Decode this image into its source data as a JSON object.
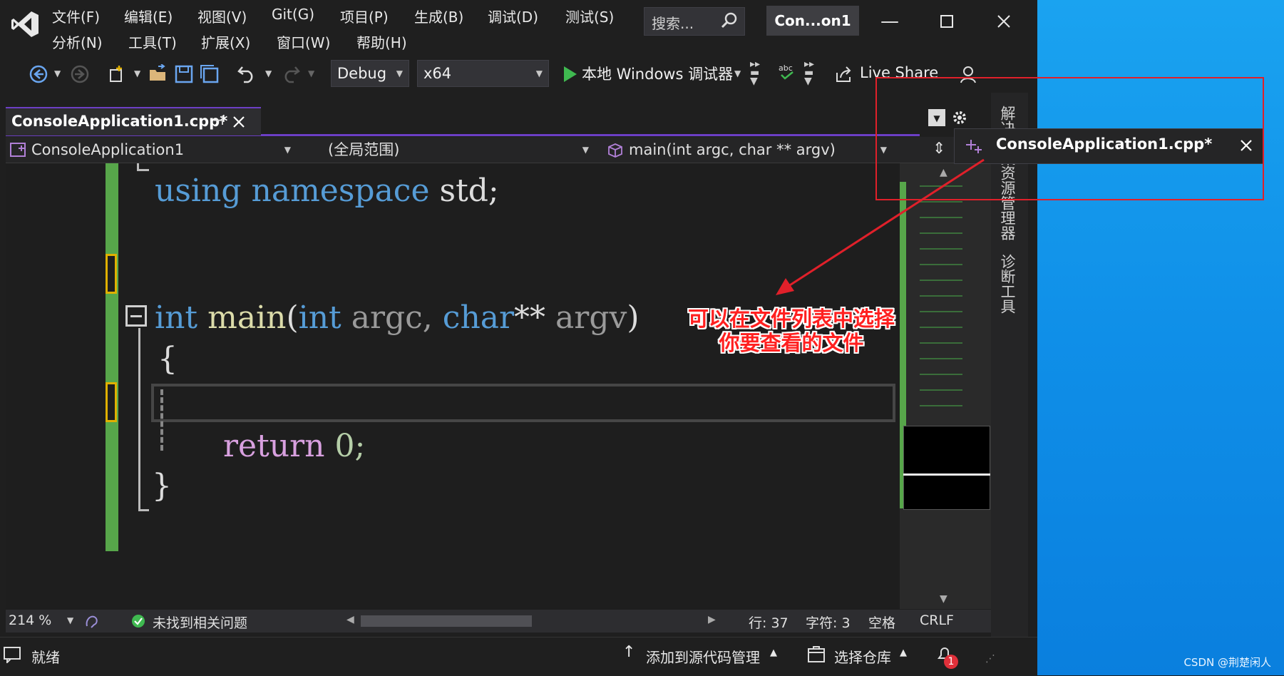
{
  "menu": {
    "row1": [
      "文件(F)",
      "编辑(E)",
      "视图(V)",
      "Git(G)",
      "项目(P)",
      "生成(B)",
      "调试(D)",
      "测试(S)"
    ],
    "row2": [
      "分析(N)",
      "工具(T)",
      "扩展(X)",
      "窗口(W)",
      "帮助(H)"
    ]
  },
  "search": {
    "placeholder": "搜索..."
  },
  "title": {
    "solution_name": "Con...on1"
  },
  "toolbar": {
    "config": "Debug",
    "platform": "x64",
    "debugger": "本地 Windows 调试器",
    "live_share": "Live Share"
  },
  "tab": {
    "label": "ConsoleApplication1.cpp*"
  },
  "navbar": {
    "project": "ConsoleApplication1",
    "scope": "(全局范围)",
    "member": "main(int argc, char ** argv)"
  },
  "code": {
    "line1": [
      "using",
      "namespace",
      "std;"
    ],
    "line2": [
      "int",
      "main",
      "(",
      "int",
      "argc,",
      "char",
      "**",
      "argv",
      ")"
    ],
    "brace_open": "{",
    "return_kw": "return",
    "return_val": "0;",
    "brace_close": "}"
  },
  "editor_status": {
    "zoom": "214 %",
    "issues": "未找到相关问题",
    "line": "行: 37",
    "char": "字符: 3",
    "spacing": "空格",
    "eol": "CRLF"
  },
  "sidebar": {
    "solution_explorer": "解决方案资源管理器",
    "diagnostics": "诊断工具"
  },
  "statusbar": {
    "ready": "就绪",
    "add_source_control": "添加到源代码管理",
    "select_repo": "选择仓库",
    "notifications": "1"
  },
  "popup": {
    "file": "ConsoleApplication1.cpp*"
  },
  "annotation": {
    "line1": "可以在文件列表中选择",
    "line2": "你要查看的文件"
  },
  "watermark": "CSDN @荆楚闲人",
  "colors": {
    "accent": "#6c3fc5",
    "annotation": "#e0202a",
    "changed_lines": "#57a64a",
    "desktop": "#0f8fe8"
  }
}
